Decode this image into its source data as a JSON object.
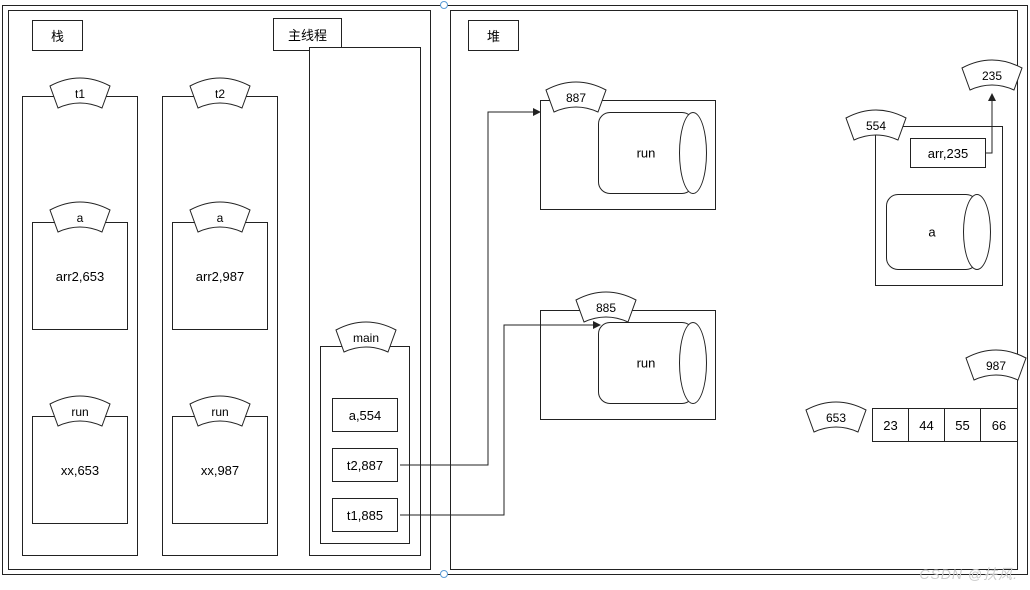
{
  "stack": {
    "title": "栈",
    "main_thread_label": "主线程",
    "threads": {
      "t1": {
        "tab": "t1",
        "frames": {
          "a": {
            "tab": "a",
            "content": "arr2,653"
          },
          "run": {
            "tab": "run",
            "content": "xx,653"
          }
        }
      },
      "t2": {
        "tab": "t2",
        "frames": {
          "a": {
            "tab": "a",
            "content": "arr2,987"
          },
          "run": {
            "tab": "run",
            "content": "xx,987"
          }
        }
      }
    },
    "main": {
      "tab": "main",
      "vars": {
        "a": "a,554",
        "t2": "t2,887",
        "t1": "t1,885"
      }
    }
  },
  "heap": {
    "title": "堆",
    "objects": {
      "obj887": {
        "addr": "887",
        "method": "run"
      },
      "obj885": {
        "addr": "885",
        "method": "run"
      },
      "obj554": {
        "addr": "554",
        "field_arr": "arr,235",
        "method": "a"
      },
      "obj235": {
        "addr": "235"
      },
      "obj987": {
        "addr": "987"
      },
      "obj653": {
        "addr": "653",
        "array": [
          "23",
          "44",
          "55",
          "66"
        ]
      }
    }
  },
  "watermark": "CSDN @扶风."
}
